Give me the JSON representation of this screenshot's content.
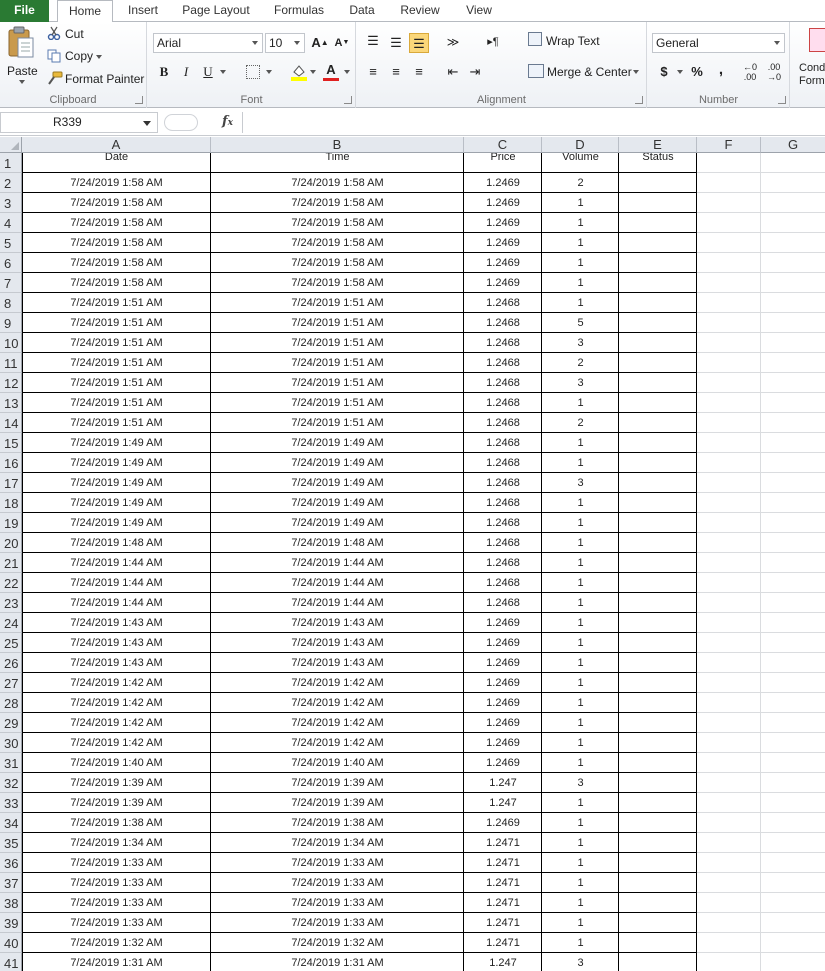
{
  "ribbon": {
    "tabs": [
      "File",
      "Home",
      "Insert",
      "Page Layout",
      "Formulas",
      "Data",
      "Review",
      "View"
    ],
    "clipboard": {
      "paste": "Paste",
      "cut": "Cut",
      "copy": "Copy",
      "format_painter": "Format Painter",
      "label": "Clipboard"
    },
    "font": {
      "name": "Arial",
      "size": "10",
      "label": "Font"
    },
    "alignment": {
      "wrap_text": "Wrap Text",
      "merge_center": "Merge & Center",
      "label": "Alignment"
    },
    "number": {
      "format": "General",
      "currency": "$",
      "percent": "%",
      "comma": ",",
      "label": "Number"
    },
    "styles": {
      "conditional_formatting": "Conditional Formatting"
    }
  },
  "formula_bar": {
    "name_box": "R339",
    "fx": "fx",
    "content": ""
  },
  "sheet": {
    "columns": [
      "A",
      "B",
      "C",
      "D",
      "E",
      "F",
      "G"
    ],
    "headers": [
      "Date",
      "Time",
      "Price",
      "Volume",
      "Status"
    ],
    "rows": [
      [
        "7/24/2019 1:58 AM",
        "7/24/2019 1:58 AM",
        "1.2469",
        "2",
        ""
      ],
      [
        "7/24/2019 1:58 AM",
        "7/24/2019 1:58 AM",
        "1.2469",
        "1",
        ""
      ],
      [
        "7/24/2019 1:58 AM",
        "7/24/2019 1:58 AM",
        "1.2469",
        "1",
        ""
      ],
      [
        "7/24/2019 1:58 AM",
        "7/24/2019 1:58 AM",
        "1.2469",
        "1",
        ""
      ],
      [
        "7/24/2019 1:58 AM",
        "7/24/2019 1:58 AM",
        "1.2469",
        "1",
        ""
      ],
      [
        "7/24/2019 1:58 AM",
        "7/24/2019 1:58 AM",
        "1.2469",
        "1",
        ""
      ],
      [
        "7/24/2019 1:51 AM",
        "7/24/2019 1:51 AM",
        "1.2468",
        "1",
        ""
      ],
      [
        "7/24/2019 1:51 AM",
        "7/24/2019 1:51 AM",
        "1.2468",
        "5",
        ""
      ],
      [
        "7/24/2019 1:51 AM",
        "7/24/2019 1:51 AM",
        "1.2468",
        "3",
        ""
      ],
      [
        "7/24/2019 1:51 AM",
        "7/24/2019 1:51 AM",
        "1.2468",
        "2",
        ""
      ],
      [
        "7/24/2019 1:51 AM",
        "7/24/2019 1:51 AM",
        "1.2468",
        "3",
        ""
      ],
      [
        "7/24/2019 1:51 AM",
        "7/24/2019 1:51 AM",
        "1.2468",
        "1",
        ""
      ],
      [
        "7/24/2019 1:51 AM",
        "7/24/2019 1:51 AM",
        "1.2468",
        "2",
        ""
      ],
      [
        "7/24/2019 1:49 AM",
        "7/24/2019 1:49 AM",
        "1.2468",
        "1",
        ""
      ],
      [
        "7/24/2019 1:49 AM",
        "7/24/2019 1:49 AM",
        "1.2468",
        "1",
        ""
      ],
      [
        "7/24/2019 1:49 AM",
        "7/24/2019 1:49 AM",
        "1.2468",
        "3",
        ""
      ],
      [
        "7/24/2019 1:49 AM",
        "7/24/2019 1:49 AM",
        "1.2468",
        "1",
        ""
      ],
      [
        "7/24/2019 1:49 AM",
        "7/24/2019 1:49 AM",
        "1.2468",
        "1",
        ""
      ],
      [
        "7/24/2019 1:48 AM",
        "7/24/2019 1:48 AM",
        "1.2468",
        "1",
        ""
      ],
      [
        "7/24/2019 1:44 AM",
        "7/24/2019 1:44 AM",
        "1.2468",
        "1",
        ""
      ],
      [
        "7/24/2019 1:44 AM",
        "7/24/2019 1:44 AM",
        "1.2468",
        "1",
        ""
      ],
      [
        "7/24/2019 1:44 AM",
        "7/24/2019 1:44 AM",
        "1.2468",
        "1",
        ""
      ],
      [
        "7/24/2019 1:43 AM",
        "7/24/2019 1:43 AM",
        "1.2469",
        "1",
        ""
      ],
      [
        "7/24/2019 1:43 AM",
        "7/24/2019 1:43 AM",
        "1.2469",
        "1",
        ""
      ],
      [
        "7/24/2019 1:43 AM",
        "7/24/2019 1:43 AM",
        "1.2469",
        "1",
        ""
      ],
      [
        "7/24/2019 1:42 AM",
        "7/24/2019 1:42 AM",
        "1.2469",
        "1",
        ""
      ],
      [
        "7/24/2019 1:42 AM",
        "7/24/2019 1:42 AM",
        "1.2469",
        "1",
        ""
      ],
      [
        "7/24/2019 1:42 AM",
        "7/24/2019 1:42 AM",
        "1.2469",
        "1",
        ""
      ],
      [
        "7/24/2019 1:42 AM",
        "7/24/2019 1:42 AM",
        "1.2469",
        "1",
        ""
      ],
      [
        "7/24/2019 1:40 AM",
        "7/24/2019 1:40 AM",
        "1.2469",
        "1",
        ""
      ],
      [
        "7/24/2019 1:39 AM",
        "7/24/2019 1:39 AM",
        "1.247",
        "3",
        ""
      ],
      [
        "7/24/2019 1:39 AM",
        "7/24/2019 1:39 AM",
        "1.247",
        "1",
        ""
      ],
      [
        "7/24/2019 1:38 AM",
        "7/24/2019 1:38 AM",
        "1.2469",
        "1",
        ""
      ],
      [
        "7/24/2019 1:34 AM",
        "7/24/2019 1:34 AM",
        "1.2471",
        "1",
        ""
      ],
      [
        "7/24/2019 1:33 AM",
        "7/24/2019 1:33 AM",
        "1.2471",
        "1",
        ""
      ],
      [
        "7/24/2019 1:33 AM",
        "7/24/2019 1:33 AM",
        "1.2471",
        "1",
        ""
      ],
      [
        "7/24/2019 1:33 AM",
        "7/24/2019 1:33 AM",
        "1.2471",
        "1",
        ""
      ],
      [
        "7/24/2019 1:33 AM",
        "7/24/2019 1:33 AM",
        "1.2471",
        "1",
        ""
      ],
      [
        "7/24/2019 1:32 AM",
        "7/24/2019 1:32 AM",
        "1.2471",
        "1",
        ""
      ],
      [
        "7/24/2019 1:31 AM",
        "7/24/2019 1:31 AM",
        "1.247",
        "3",
        ""
      ]
    ]
  },
  "colors": {
    "file_tab": "#2a7a33",
    "header_bg": "#e4e8ee",
    "active_button": "#fbd77a"
  }
}
